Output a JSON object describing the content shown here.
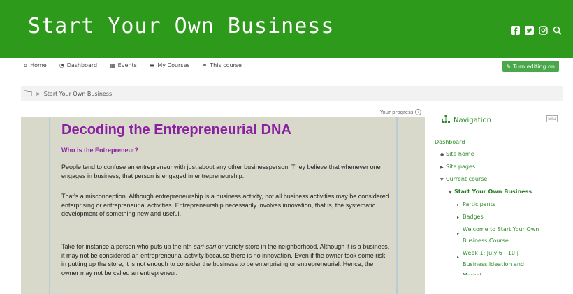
{
  "header": {
    "site_title": "Start Your Own Business",
    "social_icons": [
      "facebook-icon",
      "twitter-icon",
      "instagram-icon",
      "search-icon"
    ]
  },
  "navbar": {
    "items": [
      {
        "label": "Home",
        "icon": "home-icon"
      },
      {
        "label": "Dashboard",
        "icon": "dashboard-icon"
      },
      {
        "label": "Events",
        "icon": "calendar-icon"
      },
      {
        "label": "My Courses",
        "icon": "courses-icon"
      },
      {
        "label": "This course",
        "icon": "sitemap-icon"
      }
    ],
    "edit_button": "Turn editing on"
  },
  "breadcrumb": {
    "separator": ">",
    "current": "Start Your Own Business"
  },
  "progress": {
    "label": "Your progress"
  },
  "content": {
    "title": "Decoding the Entrepreneurial DNA",
    "subtitle": "Who is the Entrepreneur?",
    "p1": "People tend to confuse an entrepreneur with just about any other businessperson.  They believe that whenever one engages in business, that person is engaged in entrepreneurship.",
    "p2": "That's a misconception.  Although entrepreneurship is a business activity, not all business activities may be considered enterprising or entrepreneurial activities.  Entrepreneurship necessarily involves innovation, that is, the systematic development of something new and useful.",
    "p3_a": "Take for instance a person who puts up the nth ",
    "p3_italic": "sari-sari",
    "p3_b": " or variety store in the neighborhood.  Although it is a business, it may not be considered an entrepreneurial activity because there is no innovation. Even if the owner took some risk in putting up the store, it is not enough to consider the business to be enterprising or entrepreneurial.  Hence, the owner may not be called an entrepreneur."
  },
  "navigation": {
    "title": "Navigation",
    "dashboard": "Dashboard",
    "site_home": "Site home",
    "site_pages": "Site pages",
    "current_course": "Current course",
    "course_name": "Start Your Own Business",
    "participants": "Participants",
    "badges": "Badges",
    "welcome": "Welcome to Start Your Own Business Course",
    "week1": "Week 1: July 6 - 10 | Business Ideation and Market...",
    "colors": {
      "accent": "#2e9a1b",
      "link": "#2d8a2a",
      "title_purple": "#8a1fa0",
      "panel_bg": "#d8d9cb"
    }
  }
}
